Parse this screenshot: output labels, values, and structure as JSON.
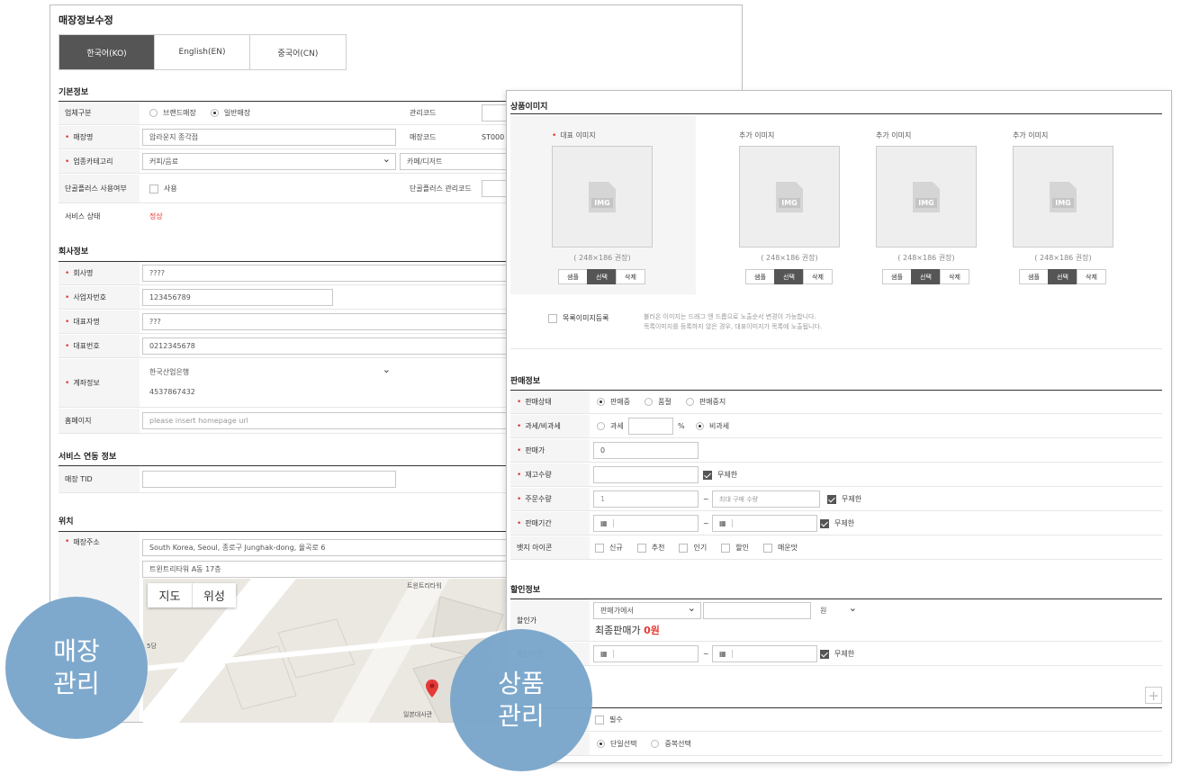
{
  "store": {
    "title": "매장정보수정",
    "lang_tabs": [
      "한국어(KO)",
      "English(EN)",
      "중국어(CN)"
    ],
    "basic": {
      "section": "기본정보",
      "biz_type_label": "업체구분",
      "biz_type_opt1": "브랜드매장",
      "biz_type_opt2": "일반매장",
      "mgmt_code_label": "관리코드",
      "store_name_label": "매장명",
      "store_name_value": "압라운지 종각점",
      "store_code_label": "매장코드",
      "store_code_value": "ST000",
      "category_label": "업종카테고리",
      "category_value": "커피/음료",
      "category_value2": "카페/디저트",
      "danggol_use_label": "단골플러스 사용여부",
      "danggol_use_opt": "사용",
      "danggol_code_label": "단골플러스 관리코드",
      "service_status_label": "서비스 상태",
      "service_status_value": "정상"
    },
    "company": {
      "section": "회사정보",
      "name_label": "회사명",
      "name_value": "????",
      "bizno_label": "사업자번호",
      "bizno_value": "123456789",
      "ceo_label": "대표자명",
      "ceo_value": "???",
      "phone_label": "대표번호",
      "phone_value": "0212345678",
      "account_label": "계좌정보",
      "bank_value": "한국산업은행",
      "account_value": "4537867432",
      "homepage_label": "홈페이지",
      "homepage_placeholder": "please insert homepage url"
    },
    "service": {
      "section": "서비스 연동 정보",
      "tid_label": "매장 TID"
    },
    "location": {
      "section": "위치",
      "address_label": "매장주소",
      "address1": "South Korea, Seoul, 종로구 Junghak-dong, 율곡로 6",
      "address2": "트윈트리타워 A동 17층",
      "map_btn_map": "지도",
      "map_btn_sat": "위성",
      "map_label_tower": "트윈트리타워",
      "map_label_embassy": "일본대사관",
      "map_label_left": "5당"
    }
  },
  "product": {
    "image": {
      "section": "상품이미지",
      "main_caption": "대표 이미지",
      "extra_caption": "추가 이미지",
      "img_text": "IMG",
      "hint": "( 248×186 권장)",
      "btn_sample": "샘플",
      "btn_select": "선택",
      "btn_delete": "삭제",
      "list_image_label": "목록이미지등록",
      "list_note1": "불러온 이미지는 드래그 앤 드롭으로 노출순서 변경이 가능합니다.",
      "list_note2": "목록이미지를 등록하지 않은 경우, 대표이미지가 목록에 노출됩니다."
    },
    "sale": {
      "section": "판매정보",
      "status_label": "판매상태",
      "status_opts": [
        "판매중",
        "품절",
        "판매중지"
      ],
      "tax_label": "과세/비과세",
      "tax_opt1": "과세",
      "tax_unit": "%",
      "tax_opt2": "비과세",
      "price_label": "판매가",
      "price_value": "0",
      "stock_label": "재고수량",
      "unlimited": "무제한",
      "order_label": "주문수량",
      "order_min": "1",
      "order_max_placeholder": "최대 구매 수량",
      "period_label": "판매기간",
      "tilde": "~",
      "calendar_glyph": "▦",
      "badge_label": "뱃지 아이콘",
      "badges": [
        "신규",
        "추천",
        "인기",
        "할인",
        "매운맛"
      ]
    },
    "discount": {
      "section": "할인정보",
      "price_label": "할인가",
      "basis_value": "판매가에서",
      "unit_value": "원",
      "final_label": "최종판매가",
      "final_value": "0원",
      "period_label": "할인기간",
      "unlimited": "무제한"
    },
    "option": {
      "plus": "+",
      "required_opt": "필수",
      "single_select": "단일선택",
      "multi_select": "중복선택"
    }
  },
  "bubbles": {
    "store_line1": "매장",
    "store_line2": "관리",
    "product_line1": "상품",
    "product_line2": "관리"
  }
}
